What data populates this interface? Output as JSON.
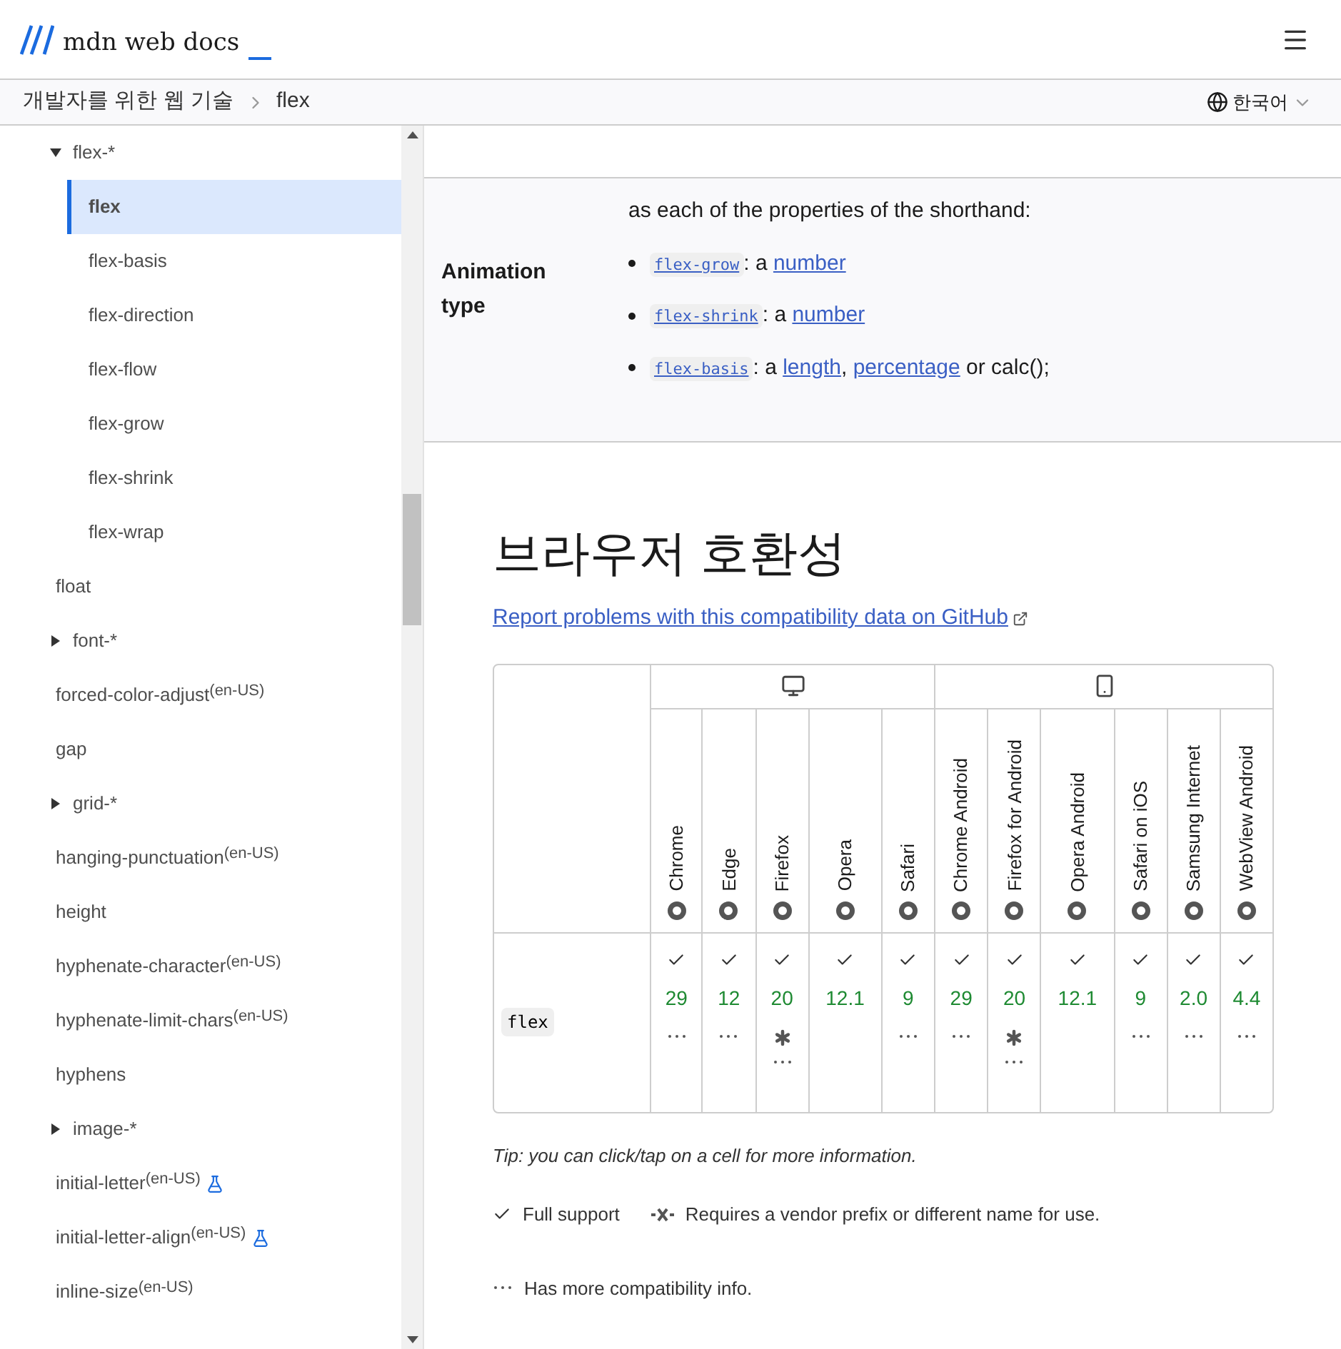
{
  "header": {
    "logo_text": "mdn web docs"
  },
  "breadcrumb": {
    "items": [
      "개발자를 위한 웹 기술",
      "flex"
    ],
    "language": "한국어"
  },
  "sidebar": {
    "items": [
      {
        "label": "flex-*",
        "kind": "group",
        "expanded": true,
        "children": [
          {
            "label": "flex",
            "selected": true
          },
          {
            "label": "flex-basis",
            "selected": false
          },
          {
            "label": "flex-direction",
            "selected": false
          },
          {
            "label": "flex-flow",
            "selected": false
          },
          {
            "label": "flex-grow",
            "selected": false
          },
          {
            "label": "flex-shrink",
            "selected": false
          },
          {
            "label": "flex-wrap",
            "selected": false
          }
        ]
      },
      {
        "label": "float",
        "kind": "link"
      },
      {
        "label": "font-*",
        "kind": "group",
        "expanded": false
      },
      {
        "label": "forced-color-adjust",
        "kind": "link",
        "badge": "(en-US)"
      },
      {
        "label": "gap",
        "kind": "link"
      },
      {
        "label": "grid-*",
        "kind": "group",
        "expanded": false
      },
      {
        "label": "hanging-punctuation",
        "kind": "link",
        "badge": "(en-US)"
      },
      {
        "label": "height",
        "kind": "link"
      },
      {
        "label": "hyphenate-character",
        "kind": "link",
        "badge": "(en-US)"
      },
      {
        "label": "hyphenate-limit-chars",
        "kind": "link",
        "badge": "(en-US)"
      },
      {
        "label": "hyphens",
        "kind": "link"
      },
      {
        "label": "image-*",
        "kind": "group",
        "expanded": false
      },
      {
        "label": "initial-letter",
        "kind": "link",
        "badge": "(en-US)",
        "experimental": true
      },
      {
        "label": "initial-letter-align",
        "kind": "link",
        "badge": "(en-US)",
        "experimental": true
      },
      {
        "label": "inline-size",
        "kind": "link",
        "badge": "(en-US)"
      }
    ]
  },
  "spec_row": {
    "label": "Animation type",
    "intro": "as each of the properties of the shorthand:",
    "items": [
      {
        "code": "flex-grow",
        "text": ": a ",
        "links": [
          "number"
        ]
      },
      {
        "code": "flex-shrink",
        "text": ": a ",
        "links": [
          "number"
        ]
      },
      {
        "code": "flex-basis",
        "text": ": a ",
        "links": [
          "length",
          "percentage"
        ],
        "separator": ", ",
        "tail": " or calc();"
      }
    ]
  },
  "compat": {
    "heading": "브라우저 호환성",
    "report_link": "Report problems with this compatibility data on GitHub",
    "platforms": [
      {
        "kind": "desktop",
        "browsers": [
          "Chrome",
          "Edge",
          "Firefox",
          "Opera",
          "Safari"
        ]
      },
      {
        "kind": "mobile",
        "browsers": [
          "Chrome Android",
          "Firefox for Android",
          "Opera Android",
          "Safari on iOS",
          "Samsung Internet",
          "WebView Android"
        ]
      }
    ],
    "feature": "flex",
    "cells": [
      {
        "version": "29",
        "notes": true,
        "prefix": false
      },
      {
        "version": "12",
        "notes": true,
        "prefix": false
      },
      {
        "version": "20",
        "notes": true,
        "prefix": true
      },
      {
        "version": "12.1",
        "notes": false,
        "prefix": false
      },
      {
        "version": "9",
        "notes": true,
        "prefix": false
      },
      {
        "version": "29",
        "notes": true,
        "prefix": false
      },
      {
        "version": "20",
        "notes": true,
        "prefix": true
      },
      {
        "version": "12.1",
        "notes": false,
        "prefix": false
      },
      {
        "version": "9",
        "notes": true,
        "prefix": false
      },
      {
        "version": "2.0",
        "notes": true,
        "prefix": false
      },
      {
        "version": "4.4",
        "notes": true,
        "prefix": false
      }
    ],
    "tip": "Tip: you can click/tap on a cell for more information.",
    "legend": [
      {
        "kind": "full",
        "label": "Full support"
      },
      {
        "kind": "prefix",
        "label": "Requires a vendor prefix or different name for use."
      },
      {
        "kind": "notes",
        "label": "Has more compatibility info."
      }
    ]
  }
}
